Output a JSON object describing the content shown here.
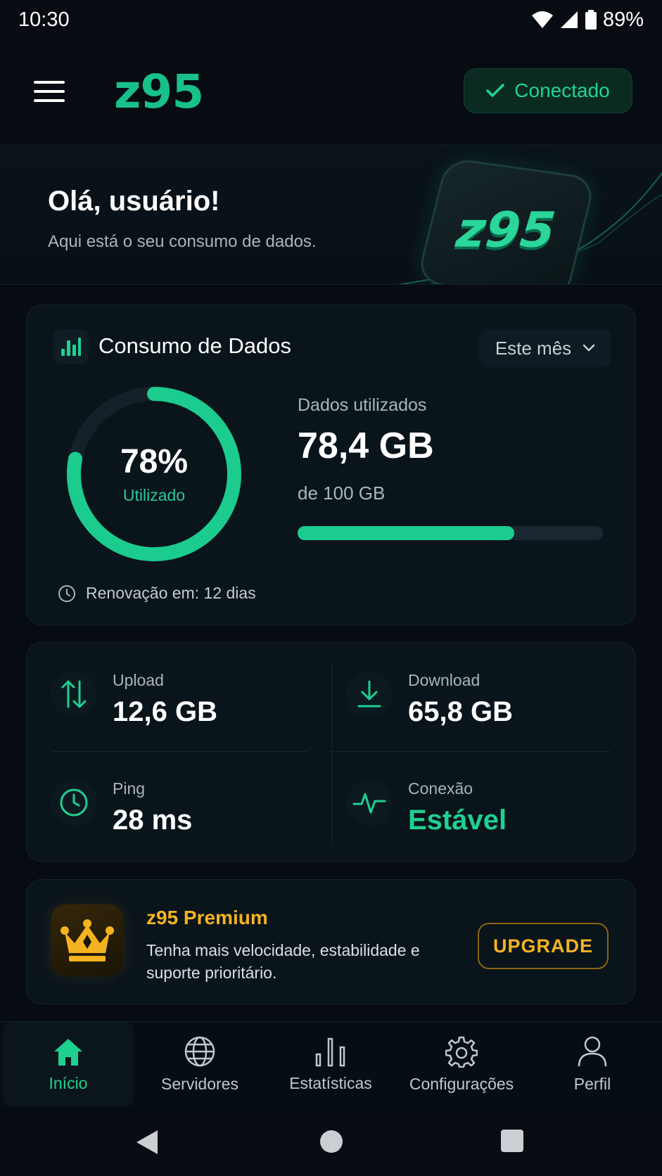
{
  "status_bar": {
    "time": "10:30",
    "battery": "89%"
  },
  "header": {
    "logo": "z95",
    "connection_status": "Conectado"
  },
  "hero": {
    "greeting": "Olá, usuário!",
    "subtitle": "Aqui está o seu consumo de dados.",
    "logo_text": "z95"
  },
  "usage": {
    "title": "Consumo de Dados",
    "period": "Este mês",
    "percent_text": "78%",
    "percent_value": 78,
    "percent_label": "Utilizado",
    "used_label": "Dados utilizados",
    "used_value": "78,4 GB",
    "total": "de 100 GB",
    "bar_fraction": 0.71,
    "renewal": "Renovação em: 12 dias"
  },
  "stats": {
    "upload_label": "Upload",
    "upload_value": "12,6 GB",
    "download_label": "Download",
    "download_value": "65,8 GB",
    "ping_label": "Ping",
    "ping_value": "28 ms",
    "connection_label": "Conexão",
    "connection_value": "Estável"
  },
  "premium": {
    "title": "z95 Premium",
    "description": "Tenha mais velocidade, estabilidade e suporte prioritário.",
    "button": "UPGRADE"
  },
  "nav": {
    "items": [
      {
        "label": "Início",
        "icon": "home-icon",
        "active": true
      },
      {
        "label": "Servidores",
        "icon": "globe-icon",
        "active": false
      },
      {
        "label": "Estatísticas",
        "icon": "bar-chart-icon",
        "active": false
      },
      {
        "label": "Configurações",
        "icon": "gear-icon",
        "active": false
      },
      {
        "label": "Perfil",
        "icon": "user-icon",
        "active": false
      }
    ]
  },
  "colors": {
    "accent": "#1fd090",
    "premium": "#f4b321",
    "background": "#060c11"
  }
}
